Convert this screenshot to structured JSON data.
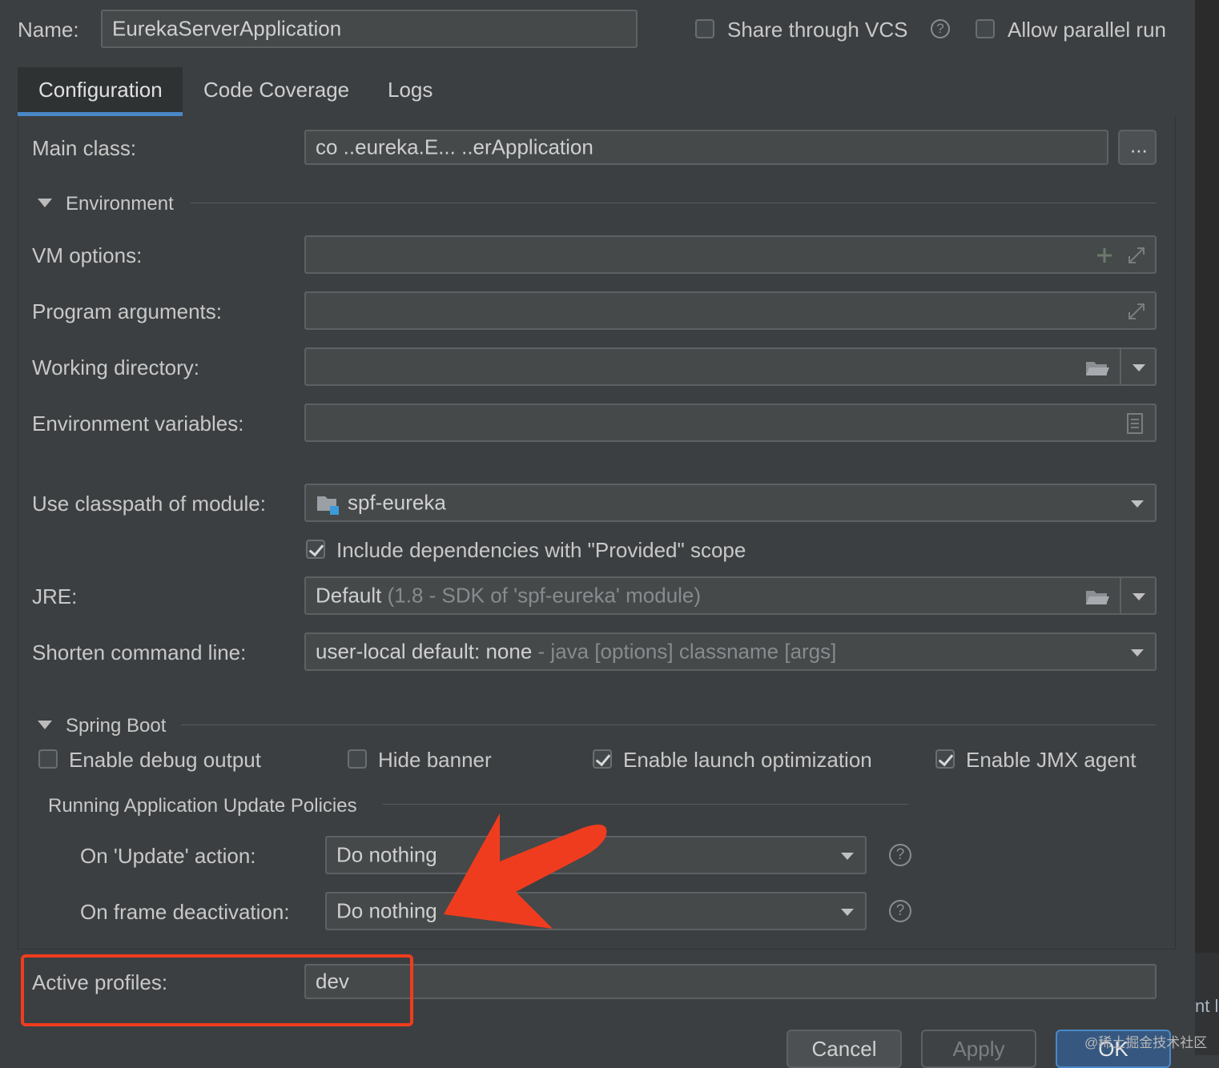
{
  "header": {
    "name_label": "Name:",
    "name_value": "EurekaServerApplication",
    "share_vcs_label": "Share through VCS",
    "parallel_label": "Allow parallel run"
  },
  "tabs": [
    {
      "label": "Configuration",
      "active": true
    },
    {
      "label": "Code Coverage",
      "active": false
    },
    {
      "label": "Logs",
      "active": false
    }
  ],
  "config": {
    "main_class_label": "Main class:",
    "main_class_value": "co    ..eureka.E...  ..erApplication",
    "browse_label": "...",
    "environment_title": "Environment",
    "vm_options_label": "VM options:",
    "program_args_label": "Program arguments:",
    "working_dir_label": "Working directory:",
    "env_vars_label": "Environment variables:",
    "classpath_label": "Use classpath of module:",
    "classpath_value": "spf-eureka",
    "include_deps_label": "Include dependencies with \"Provided\" scope",
    "jre_label": "JRE:",
    "jre_value": "Default",
    "jre_detail": "(1.8 - SDK of 'spf-eureka' module)",
    "shorten_label": "Shorten command line:",
    "shorten_value": "user-local default: none",
    "shorten_detail": "- java [options] classname [args]"
  },
  "spring": {
    "title": "Spring Boot",
    "debug_label": "Enable debug output",
    "hide_banner_label": "Hide banner",
    "launch_opt_label": "Enable launch optimization",
    "jmx_label": "Enable JMX agent",
    "policies_title": "Running Application Update Policies",
    "update_label": "On 'Update' action:",
    "update_value": "Do nothing",
    "frame_label": "On frame deactivation:",
    "frame_value": "Do nothing",
    "profiles_label": "Active profiles:",
    "profiles_value": "dev"
  },
  "buttons": {
    "cancel": "Cancel",
    "apply": "Apply",
    "ok": "OK"
  },
  "watermark": "@稀土掘金技术社区",
  "side_text": "nt l",
  "colors": {
    "background": "#3c3f41",
    "accent": "#4a88c7",
    "annotation": "#f03c1e"
  }
}
